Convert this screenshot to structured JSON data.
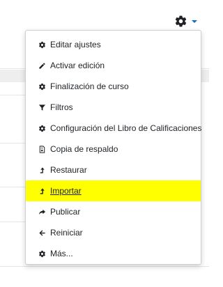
{
  "colors": {
    "accent": "#0f6fc5",
    "highlight": "#ffff00",
    "icon": "#1d2125"
  },
  "trigger": {
    "icon": "gear-icon",
    "caret_icon": "caret-down-icon"
  },
  "menu": {
    "items": [
      {
        "label": "Editar ajustes",
        "icon": "gear-icon"
      },
      {
        "label": "Activar edición",
        "icon": "pencil-icon"
      },
      {
        "label": "Finalización de curso",
        "icon": "gear-icon"
      },
      {
        "label": "Filtros",
        "icon": "filter-icon"
      },
      {
        "label": "Configuración del Libro de Calificaciones",
        "icon": "gear-icon"
      },
      {
        "label": "Copia de respaldo",
        "icon": "file-archive-icon"
      },
      {
        "label": "Restaurar",
        "icon": "level-up-icon"
      },
      {
        "label": "Importar",
        "icon": "level-up-icon",
        "highlighted": true
      },
      {
        "label": "Publicar",
        "icon": "share-icon"
      },
      {
        "label": "Reiniciar",
        "icon": "arrow-left-icon"
      },
      {
        "label": "Más...",
        "icon": "gear-icon"
      }
    ]
  }
}
